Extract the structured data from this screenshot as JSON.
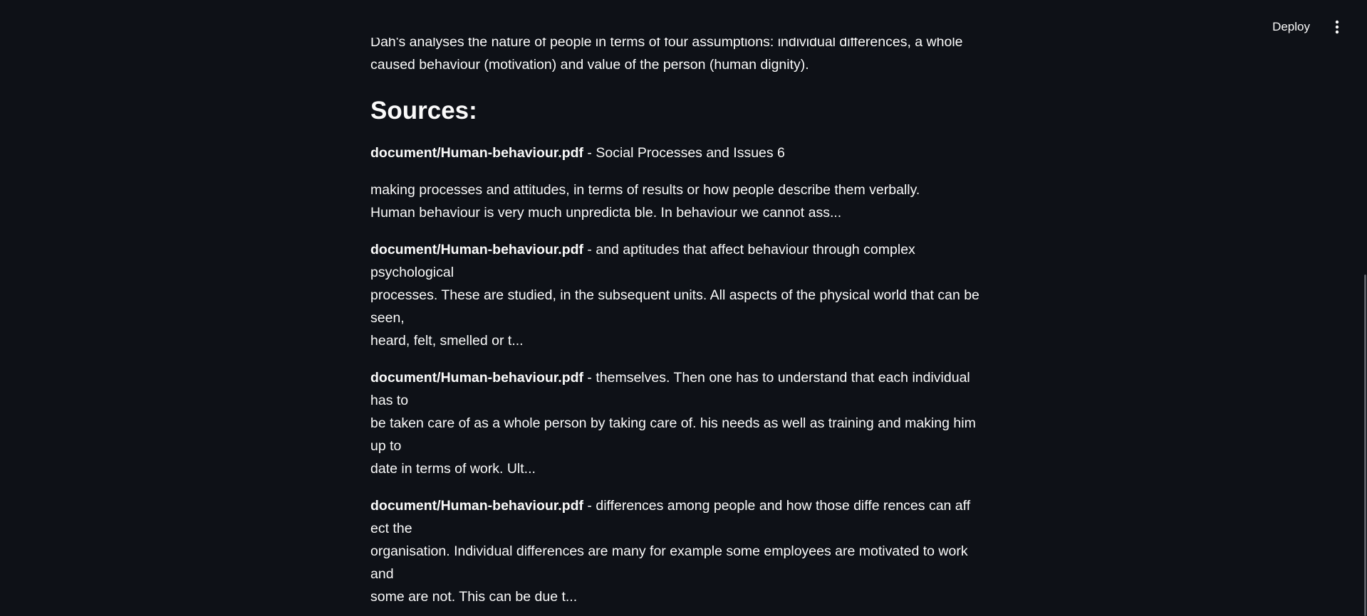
{
  "header": {
    "deploy_label": "Deploy",
    "menu_icon": "vertical-ellipsis-icon"
  },
  "content": {
    "intro_line1": "Dah's analyses the nature of people in terms of four assumptions: individual differences, a whole person,",
    "intro_line2": "caused behaviour (motivation) and value of the person (human dignity).",
    "sources_heading": "Sources:",
    "sources": [
      {
        "name": "document/Human-behaviour.pdf",
        "line1": " - Social Processes and Issues 6"
      },
      {
        "line1": "making processes and attitudes, in terms of results or how people describe them verbally.",
        "line2": "Human behaviour is very much unpredicta ble. In behaviour we cannot ass..."
      },
      {
        "name": "document/Human-behaviour.pdf",
        "line1": " - and aptitudes that affect behaviour through complex psychological",
        "line2": "processes. These are studied, in the subsequent units. All aspects of the physical world that can be seen,",
        "line3": "heard, felt, smelled or t..."
      },
      {
        "name": "document/Human-behaviour.pdf",
        "line1": " - themselves. Then one has to understand that each individual has to",
        "line2": "be taken care of as a whole person by taking care of. his needs as well as training and making him up to",
        "line3": "date in terms of work. Ult..."
      },
      {
        "name": "document/Human-behaviour.pdf",
        "line1": " - differences among people and how those diffe rences can aff ect the",
        "line2": "organisation. Individual differences are many for example some employees are motivated to work and",
        "line3": "some are not. This can be due t..."
      }
    ]
  }
}
